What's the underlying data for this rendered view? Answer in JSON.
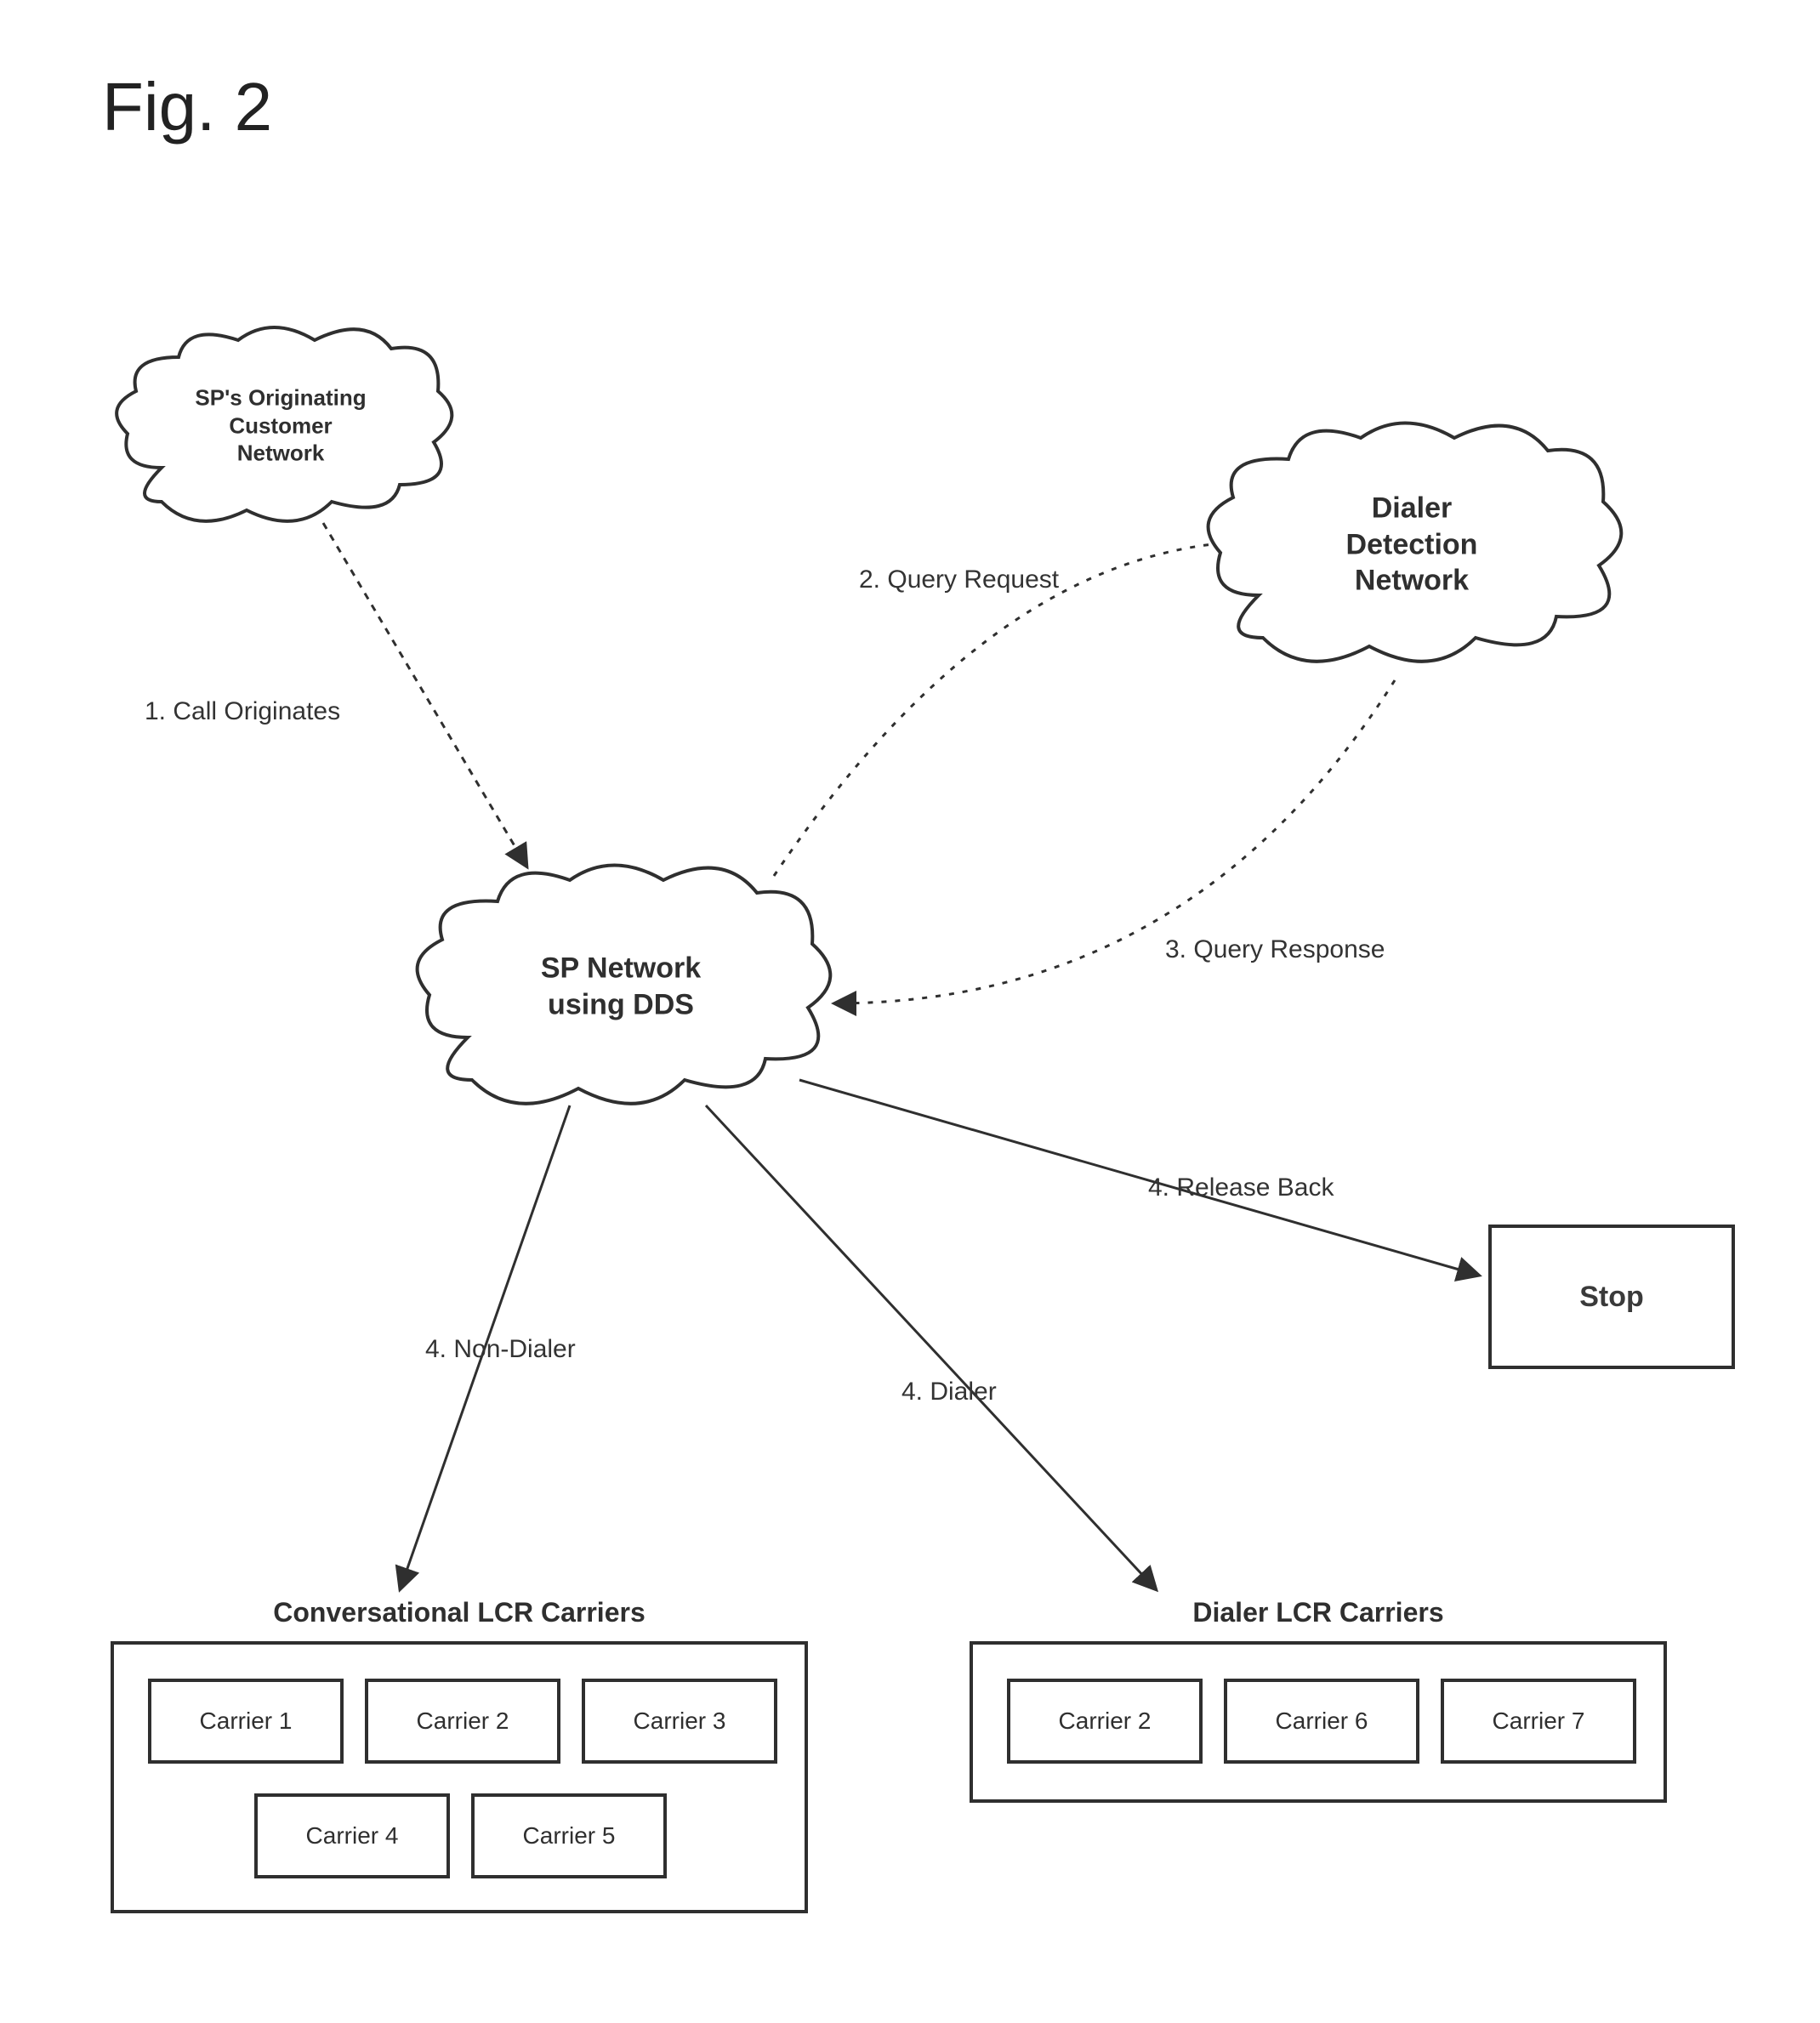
{
  "figure_label": "Fig. 2",
  "clouds": {
    "customer": {
      "line1": "SP's Originating",
      "line2": "Customer",
      "line3": "Network"
    },
    "dds": {
      "line1": "SP Network",
      "line2": "using DDS"
    },
    "ddn": {
      "line1": "Dialer",
      "line2": "Detection",
      "line3": "Network"
    }
  },
  "edges": {
    "call_originates": "1.  Call Originates",
    "query_request": "2.  Query Request",
    "query_response": "3.  Query Response",
    "release_back": "4.  Release Back",
    "non_dialer": "4.  Non-Dialer",
    "dialer": "4.  Dialer"
  },
  "stop_label": "Stop",
  "groups": {
    "conversational": {
      "title": "Conversational LCR Carriers",
      "carriers": [
        "Carrier 1",
        "Carrier 2",
        "Carrier 3",
        "Carrier 4",
        "Carrier 5"
      ]
    },
    "dialer": {
      "title": "Dialer LCR Carriers",
      "carriers": [
        "Carrier 2",
        "Carrier 6",
        "Carrier 7"
      ]
    }
  }
}
